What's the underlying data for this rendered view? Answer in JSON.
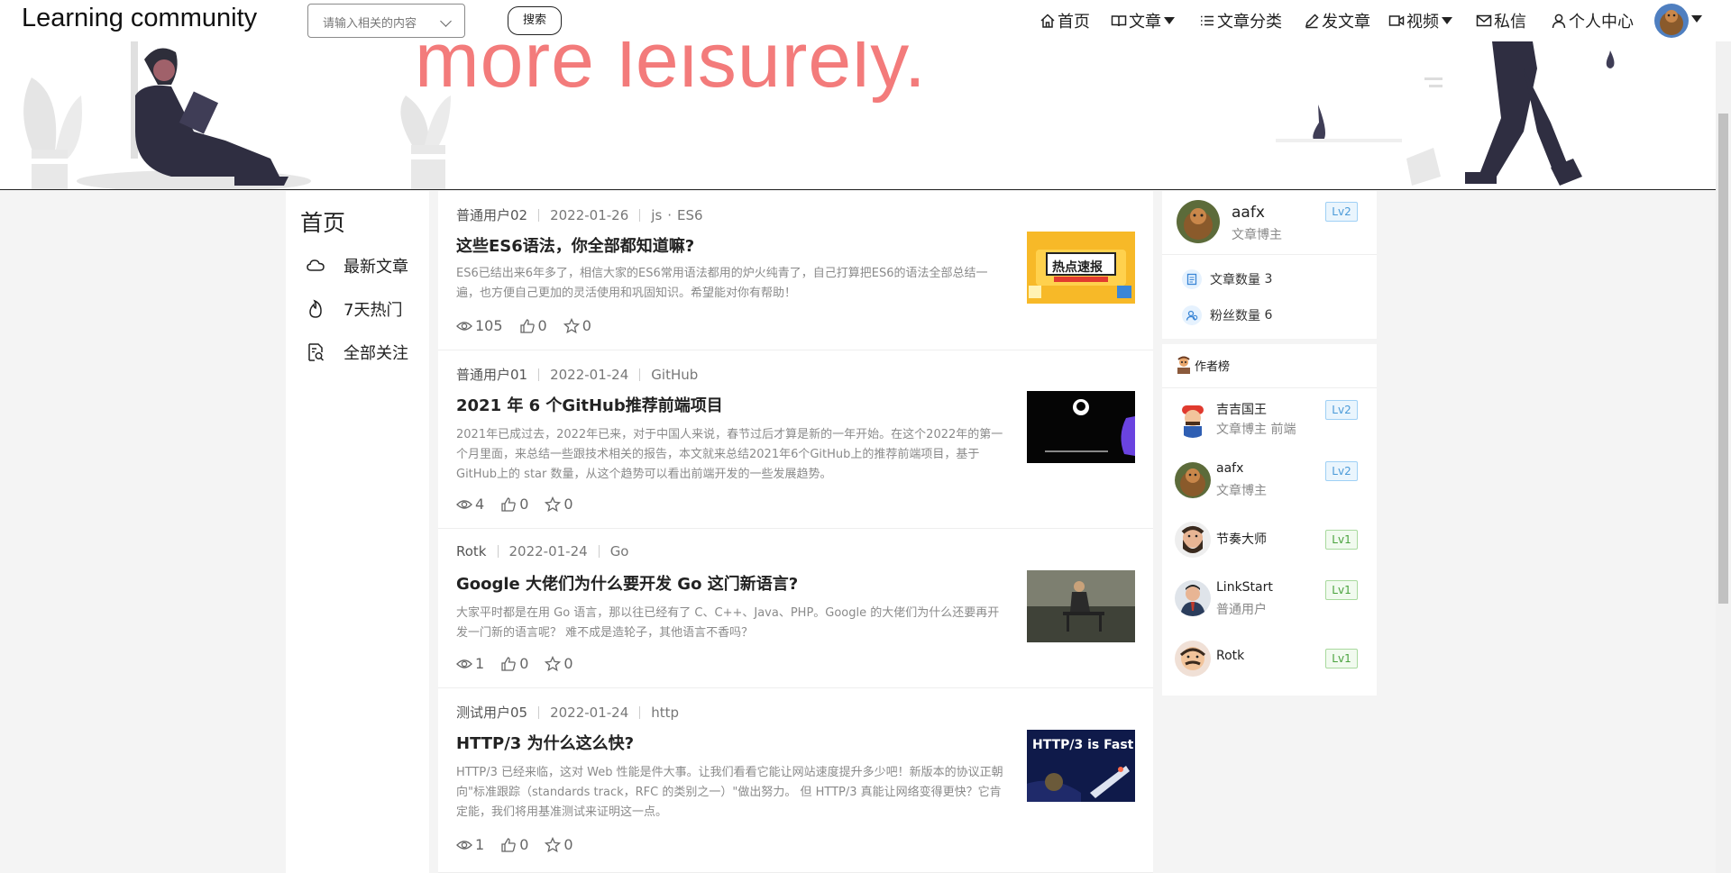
{
  "header": {
    "brand": "Learning community",
    "search_placeholder": "请输入相关的内容",
    "search_button": "搜索",
    "nav": {
      "home": "首页",
      "articles": "文章",
      "categories": "文章分类",
      "write": "发文章",
      "video": "视频",
      "messages": "私信",
      "profile": "个人中心"
    }
  },
  "banner": {
    "text": "more leisurely."
  },
  "left_menu": {
    "title": "首页",
    "items": [
      "最新文章",
      "7天热门",
      "全部关注"
    ]
  },
  "articles": [
    {
      "author": "普通用户02",
      "date": "2022-01-26",
      "tags": [
        "js",
        "ES6"
      ],
      "title": "这些ES6语法，你全部都知道嘛?",
      "summary": "ES6已结出来6年多了，相信大家的ES6常用语法都用的炉火纯青了，自己打算把ES6的语法全部总结一遍，也方便自己更加的灵活使用和巩固知识。希望能对你有帮助！",
      "views": "105",
      "likes": "0",
      "stars": "0",
      "thumb_text": "热点速报"
    },
    {
      "author": "普通用户01",
      "date": "2022-01-24",
      "tags": [
        "GitHub"
      ],
      "title": "2021 年 6 个GitHub推荐前端项目",
      "summary": "2021年已成过去，2022年已来，对于中国人来说，春节过后才算是新的一年开始。在这个2022年的第一个月里面，来总结一些跟技术相关的报告，本文就来总结2021年6个GitHub上的推荐前端项目，基于GitHub上的 star 数量，从这个趋势可以看出前端开发的一些发展趋势。",
      "views": "4",
      "likes": "0",
      "stars": "0"
    },
    {
      "author": "Rotk",
      "date": "2022-01-24",
      "tags": [
        "Go"
      ],
      "title": "Google 大佬们为什么要开发 Go 这门新语言?",
      "summary": "大家平时都是在用 Go 语言，那以往已经有了 C、C++、Java、PHP。Google 的大佬们为什么还要再开发一门新的语言呢？ 难不成是造轮子，其他语言不香吗？",
      "views": "1",
      "likes": "0",
      "stars": "0"
    },
    {
      "author": "测试用户05",
      "date": "2022-01-24",
      "tags": [
        "http"
      ],
      "title": "HTTP/3 为什么这么快?",
      "summary": "HTTP/3 已经来临，这对 Web 性能是件大事。让我们看看它能让网站速度提升多少吧！新版本的协议正朝向\"标准跟踪（standards track，RFC 的类别之一）\"做出努力。 但 HTTP/3 真能让网络变得更快？它肯定能，我们将用基准测试来证明这一点。",
      "views": "1",
      "likes": "0",
      "stars": "0",
      "thumb_text": "HTTP/3 is Fast"
    }
  ],
  "profile": {
    "name": "aafx",
    "role": "文章博主",
    "level": "Lv2",
    "article_count_label": "文章数量",
    "article_count": "3",
    "fans_label": "粉丝数量",
    "fans": "6"
  },
  "author_rank": {
    "title": "作者榜",
    "authors": [
      {
        "name": "吉吉国王",
        "role": "文章博主 前端",
        "level": "Lv2"
      },
      {
        "name": "aafx",
        "role": "文章博主",
        "level": "Lv2"
      },
      {
        "name": "节奏大师",
        "role": "",
        "level": "Lv1"
      },
      {
        "name": "LinkStart",
        "role": "普通用户",
        "level": "Lv1"
      },
      {
        "name": "Rotk",
        "role": "",
        "level": "Lv1"
      }
    ]
  }
}
